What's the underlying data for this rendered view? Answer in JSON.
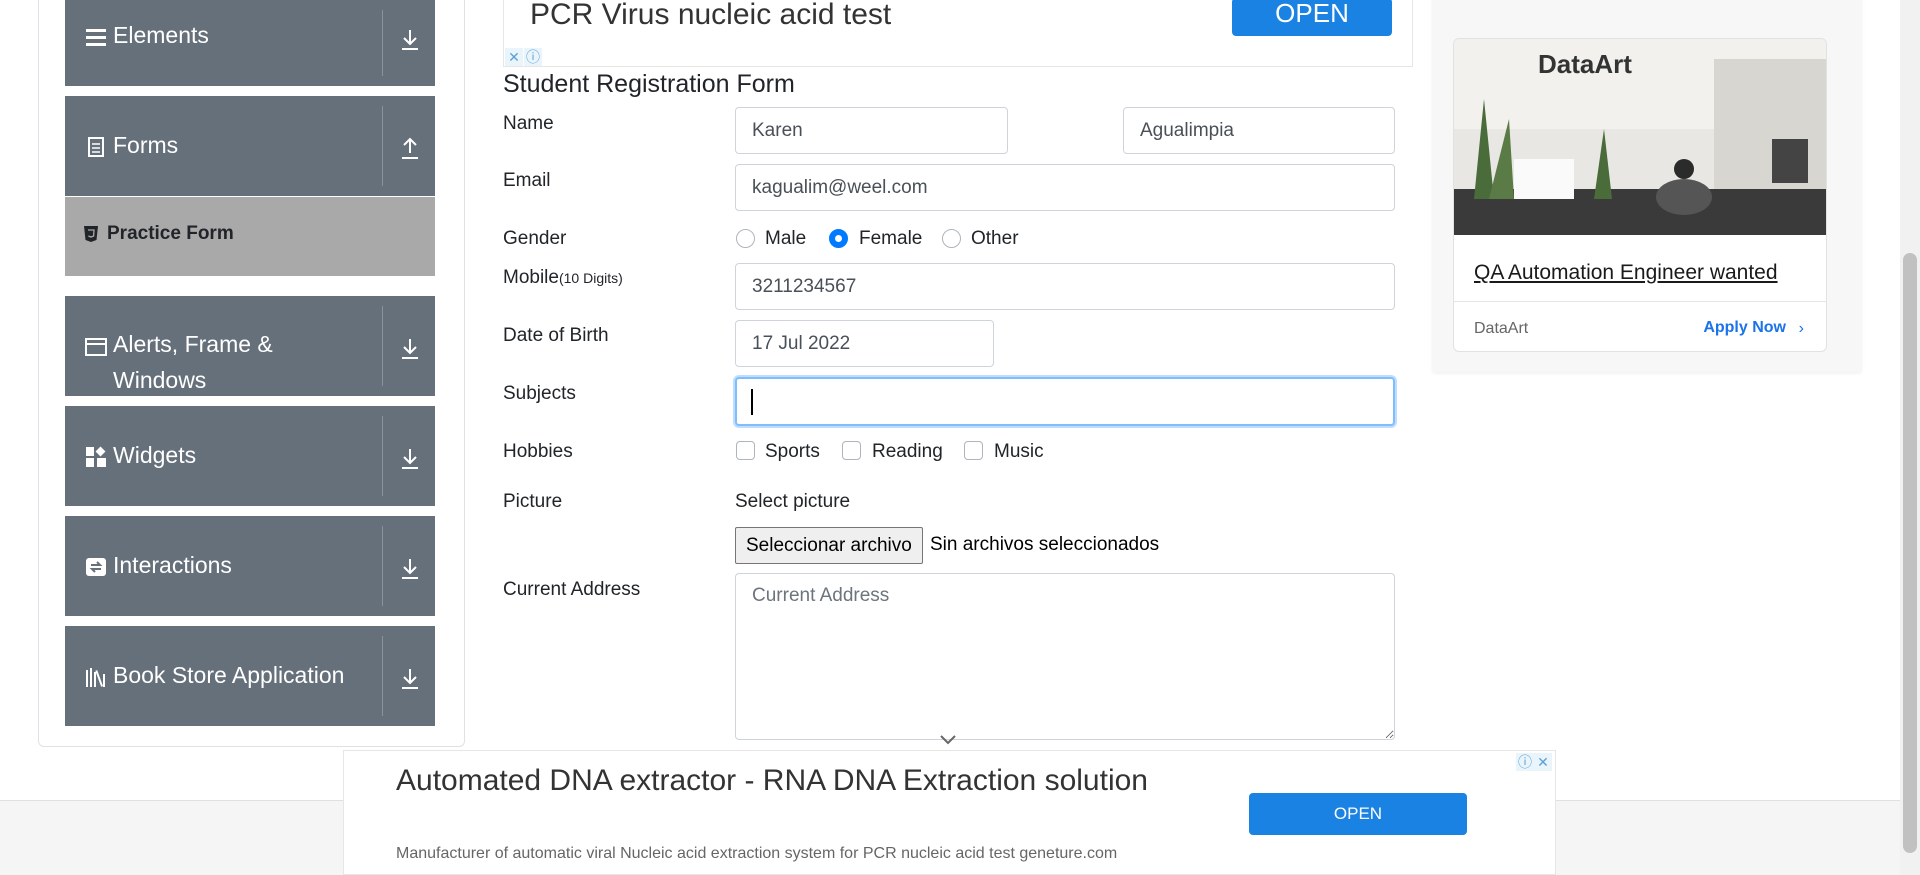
{
  "sidebar": {
    "groups": [
      {
        "label": "Elements",
        "icon": "hamburger-icon",
        "toggle": "download-arrow-icon"
      },
      {
        "label": "Forms",
        "icon": "document-icon",
        "toggle": "upload-arrow-icon"
      },
      {
        "label": "Alerts, Frame & Windows",
        "icon": "window-icon",
        "toggle": "download-arrow-icon"
      },
      {
        "label": "Widgets",
        "icon": "widgets-icon",
        "toggle": "download-arrow-icon"
      },
      {
        "label": "Interactions",
        "icon": "interactions-icon",
        "toggle": "download-arrow-icon"
      },
      {
        "label": "Book Store Application",
        "icon": "books-icon",
        "toggle": "download-arrow-icon"
      }
    ],
    "active_item": "Practice Form"
  },
  "top_ad": {
    "text": "PCR Virus nucleic acid test",
    "button": "OPEN"
  },
  "form": {
    "title": "Student Registration Form",
    "name_label": "Name",
    "first_name": "Karen",
    "last_name": "Agualimpia",
    "email_label": "Email",
    "email": "kagualim@weel.com",
    "gender_label": "Gender",
    "gender_options": [
      "Male",
      "Female",
      "Other"
    ],
    "gender_selected": "Female",
    "mobile_label": "Mobile",
    "mobile_hint": "(10 Digits)",
    "mobile": "3211234567",
    "dob_label": "Date of Birth",
    "dob": "17 Jul 2022",
    "subjects_label": "Subjects",
    "subjects_value": "",
    "hobbies_label": "Hobbies",
    "hobbies": [
      "Sports",
      "Reading",
      "Music"
    ],
    "picture_label": "Picture",
    "select_picture": "Select picture",
    "file_button": "Seleccionar archivo",
    "file_status": "Sin archivos seleccionados",
    "address_label": "Current Address",
    "address_placeholder": "Current Address"
  },
  "right_ad": {
    "brand": "DataArt",
    "headline": "QA Automation Engineer wanted",
    "advertiser": "DataArt",
    "cta": "Apply Now"
  },
  "bottom_ad": {
    "title": "Automated DNA extractor - RNA DNA Extraction solution",
    "description": "Manufacturer of automatic viral Nucleic acid extraction system for PCR nucleic acid test geneture.com",
    "button": "OPEN"
  },
  "colors": {
    "sidebar_bg": "#66707b",
    "active_bg": "#a9a9a9",
    "primary": "#007bff",
    "ad_button": "#1a82e2"
  }
}
